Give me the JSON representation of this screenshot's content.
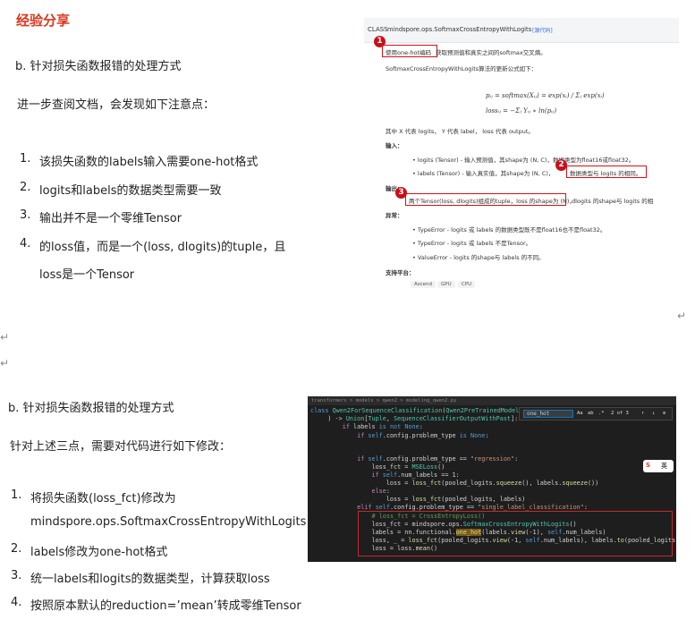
{
  "title": "经验分享",
  "section1": {
    "heading": "b. 针对损失函数报错的处理方式",
    "intro": "进一步查阅文档，会发现如下注意点：",
    "items": [
      {
        "num": "1.",
        "text": "该损失函数的labels输入需要one-hot格式"
      },
      {
        "num": "2.",
        "text": "logits和labels的数据类型需要一致"
      },
      {
        "num": "3.",
        "text": "输出并不是一个零维Tensor"
      },
      {
        "num": "4.",
        "text": "的loss值，而是一个(loss, dlogits)的tuple，且"
      }
    ],
    "item4_cont": "loss是一个Tensor"
  },
  "section2": {
    "heading": "b. 针对损失函数报错的处理方式",
    "intro": "针对上述三点，需要对代码进行如下修改：",
    "items": [
      {
        "num": "1.",
        "text": "将损失函数(loss_fct)修改为"
      },
      {
        "num": "",
        "text": "mindspore.ops.SoftmaxCrossEntropyWithLogits"
      },
      {
        "num": "2.",
        "text": "labels修改为one-hot格式"
      },
      {
        "num": "3.",
        "text": "统一labels和logits的数据类型，计算获取loss"
      },
      {
        "num": "4.",
        "text": "按照原本默认的reduction=’mean’转成零维Tensor"
      }
    ]
  },
  "enter_marks": [
    "↵",
    "↵",
    "↵"
  ],
  "doc": {
    "class_label": "CLASS",
    "class_name": "mindspore.ops.SoftmaxCrossEntropyWithLogits",
    "source_link": "[源代码]",
    "desc1_boxed": "使用one-hot编码",
    "desc1_rest": "获取预测值和真实之间的softmax交叉熵。",
    "desc2": "SoftmaxCrossEntropyWithLogits算法的更新公式如下：",
    "formula1": "pᵢⱼ = softmax(Xᵢⱼ) = exp(xᵢ) / Σⱼ exp(xᵢ)",
    "formula2": "lossᵢⱼ = −Σⱼ Yᵢⱼ ∗ ln(pᵢⱼ)",
    "where": "其中 X 代表 logits， Y 代表 label， loss 代表 output。",
    "inputs_label": "输入：",
    "input1": "• logits (Tensor) - 输入预测值，其shape为 (N, C)，数据类型为float16或float32。",
    "input2_pre": "• labels (Tensor) - 输入真实值，其shape为 (N, C)，",
    "input2_boxed": "数据类型与 logits 的相同。",
    "outputs_label": "输出：",
    "output_boxed": "两个Tensor(loss, dlogits)组成的tuple，loss 的shape为 (N)，",
    "output_rest": "dlogits 的shape与 logits 的相",
    "raises_label": "异常：",
    "raise1": "• TypeError - logits 或 labels 的数据类型既不是float16也不是float32。",
    "raise2": "• TypeError - logits 或 labels 不是Tensor。",
    "raise3": "• ValueError - logits 的shape与 labels 的不同。",
    "platforms_label": "支持平台：",
    "platforms": [
      "Ascend",
      "GPU",
      "CPU"
    ],
    "badges": [
      "1",
      "2",
      "3"
    ]
  },
  "code": {
    "breadcrumb": "transformers > models > qwen2 > modeling_qwen2.py",
    "find_query": "one_hot",
    "find_count": "2 of 3",
    "find_opts": [
      "Aa",
      "ab",
      ".*"
    ],
    "sougou": "英"
  }
}
